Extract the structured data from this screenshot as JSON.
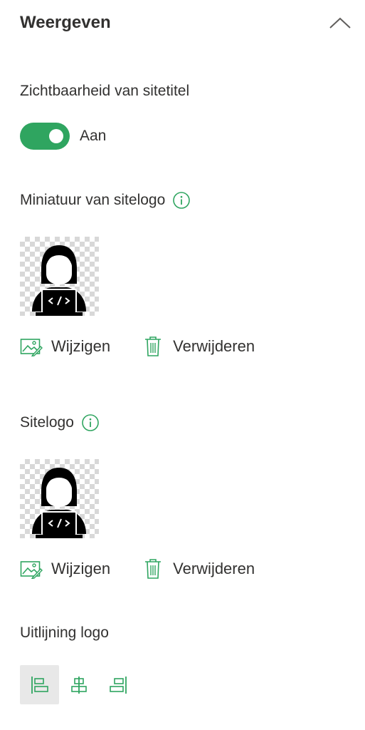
{
  "section": {
    "title": "Weergeven"
  },
  "site_title_visibility": {
    "label": "Zichtbaarheid van sitetitel",
    "toggle_state": "Aan",
    "enabled": true
  },
  "thumbnail": {
    "label": "Miniatuur van sitelogo",
    "change_label": "Wijzigen",
    "remove_label": "Verwijderen"
  },
  "site_logo": {
    "label": "Sitelogo",
    "change_label": "Wijzigen",
    "remove_label": "Verwijderen"
  },
  "logo_alignment": {
    "label": "Uitlijning logo",
    "options": [
      "left",
      "center",
      "right"
    ],
    "selected": "left"
  },
  "colors": {
    "accent": "#2fa560",
    "text": "#323130",
    "selected_bg": "#e8e8e8"
  },
  "icons": {
    "collapse": "chevron-up-icon",
    "info": "info-icon",
    "change": "image-edit-icon",
    "remove": "trash-icon",
    "align_left": "align-left-icon",
    "align_center": "align-center-icon",
    "align_right": "align-right-icon"
  }
}
